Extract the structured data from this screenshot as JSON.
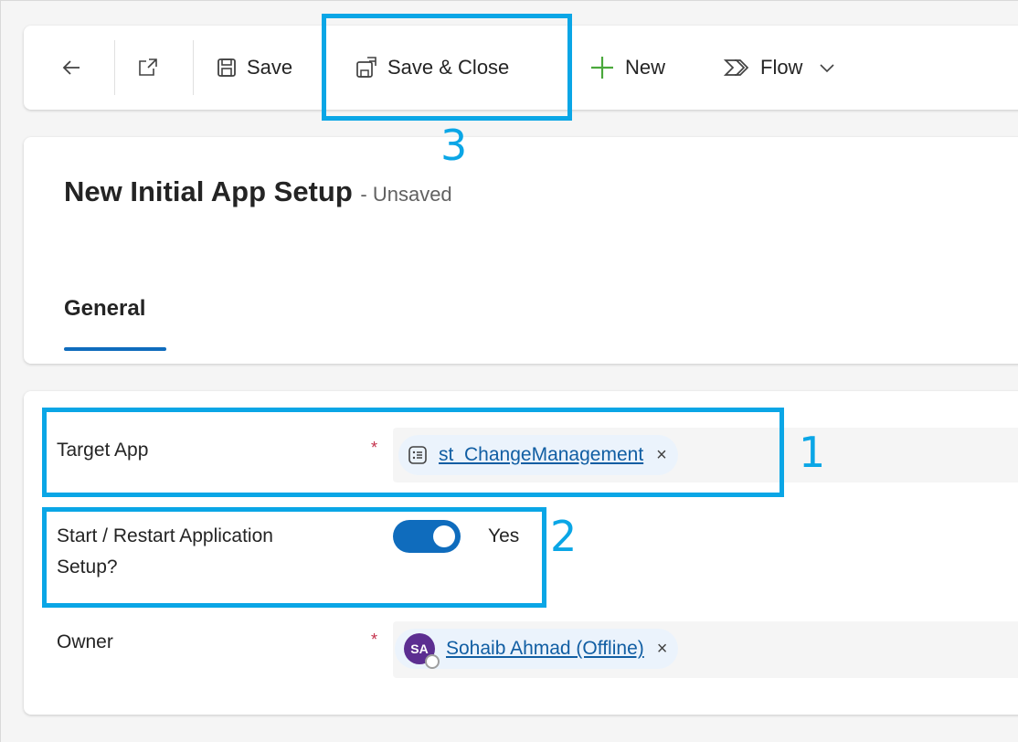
{
  "colors": {
    "accent": "#0f6cbd",
    "link": "#115ea3",
    "annotation": "#0aa6e6",
    "required": "#c4314b"
  },
  "toolbar": {
    "back_icon": "arrow-left-icon",
    "popout_icon": "open-in-new-window-icon",
    "save_label": "Save",
    "save_close_label": "Save & Close",
    "new_label": "New",
    "flow_label": "Flow"
  },
  "header": {
    "title": "New Initial App Setup",
    "status": "- Unsaved",
    "tab": "General"
  },
  "form": {
    "target_app": {
      "label": "Target App",
      "required": "*",
      "value": "st_ChangeManagement",
      "remove": "×"
    },
    "restart": {
      "label_line1": "Start / Restart Application",
      "label_line2": "Setup?",
      "toggle_on": true,
      "value": "Yes"
    },
    "owner": {
      "label": "Owner",
      "required": "*",
      "avatar_initials": "SA",
      "value": "Sohaib Ahmad (Offline)",
      "remove": "×"
    }
  },
  "annotations": {
    "one": "1",
    "two": "2",
    "three": "3"
  }
}
